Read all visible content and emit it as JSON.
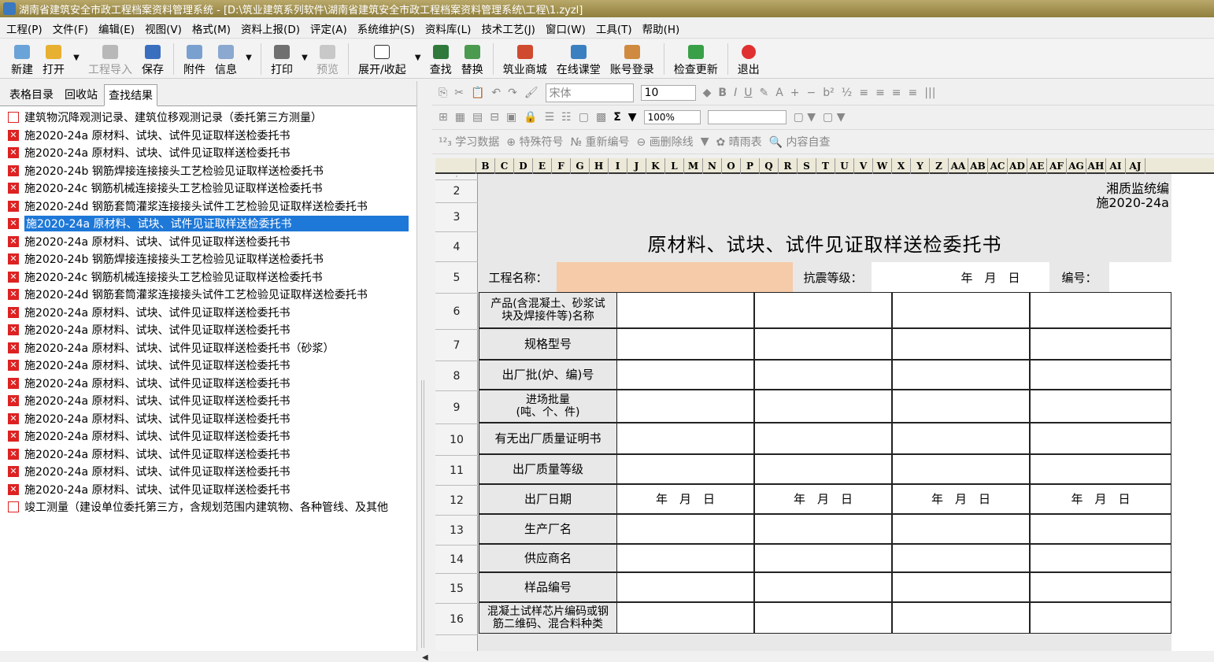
{
  "window": {
    "title": "湖南省建筑安全市政工程档案资料管理系统 - [D:\\筑业建筑系列软件\\湖南省建筑安全市政工程档案资料管理系统\\工程\\1.zyzl]"
  },
  "menu": [
    "工程(P)",
    "文件(F)",
    "编辑(E)",
    "视图(V)",
    "格式(M)",
    "资料上报(D)",
    "评定(A)",
    "系统维护(S)",
    "资料库(L)",
    "技术工艺(J)",
    "窗口(W)",
    "工具(T)",
    "帮助(H)"
  ],
  "toolbar": {
    "new": "新建",
    "open": "打开",
    "import": "工程导入",
    "save": "保存",
    "attach": "附件",
    "info": "信息",
    "print": "打印",
    "preview": "预览",
    "expand": "展开/收起",
    "find": "查找",
    "replace": "替换",
    "mall": "筑业商城",
    "classroom": "在线课堂",
    "login": "账号登录",
    "update": "检查更新",
    "exit": "退出"
  },
  "format": {
    "font": "宋体",
    "size": "10",
    "zoom": "100%",
    "learn": "学习数据",
    "special": "特殊符号",
    "renumber": "重新编号",
    "strike": "画删除线",
    "weather": "晴雨表",
    "check": "内容自查",
    "sigma": "Σ"
  },
  "tabs": [
    "表格目录",
    "回收站",
    "查找结果"
  ],
  "files": [
    {
      "t": "建筑物沉降观测记录、建筑位移观测记录（委托第三方测量）",
      "i": "doc"
    },
    {
      "t": "施2020-24a 原材料、试块、试件见证取样送检委托书",
      "i": "err"
    },
    {
      "t": "施2020-24a 原材料、试块、试件见证取样送检委托书",
      "i": "err"
    },
    {
      "t": "施2020-24b 钢筋焊接连接接头工艺检验见证取样送检委托书",
      "i": "err"
    },
    {
      "t": "施2020-24c 钢筋机械连接接头工艺检验见证取样送检委托书",
      "i": "err"
    },
    {
      "t": "施2020-24d 钢筋套筒灌浆连接接头试件工艺检验见证取样送检委托书",
      "i": "err"
    },
    {
      "t": "施2020-24a 原材料、试块、试件见证取样送检委托书",
      "i": "err",
      "sel": true
    },
    {
      "t": "施2020-24a 原材料、试块、试件见证取样送检委托书",
      "i": "err"
    },
    {
      "t": "施2020-24b 钢筋焊接连接接头工艺检验见证取样送检委托书",
      "i": "err"
    },
    {
      "t": "施2020-24c 钢筋机械连接接头工艺检验见证取样送检委托书",
      "i": "err"
    },
    {
      "t": "施2020-24d 钢筋套筒灌浆连接接头试件工艺检验见证取样送检委托书",
      "i": "err"
    },
    {
      "t": "施2020-24a 原材料、试块、试件见证取样送检委托书",
      "i": "err"
    },
    {
      "t": "施2020-24a 原材料、试块、试件见证取样送检委托书",
      "i": "err"
    },
    {
      "t": "施2020-24a 原材料、试块、试件见证取样送检委托书（砂浆）",
      "i": "err"
    },
    {
      "t": "施2020-24a 原材料、试块、试件见证取样送检委托书",
      "i": "err"
    },
    {
      "t": "施2020-24a 原材料、试块、试件见证取样送检委托书",
      "i": "err"
    },
    {
      "t": "施2020-24a 原材料、试块、试件见证取样送检委托书",
      "i": "err"
    },
    {
      "t": "施2020-24a 原材料、试块、试件见证取样送检委托书",
      "i": "err"
    },
    {
      "t": "施2020-24a 原材料、试块、试件见证取样送检委托书",
      "i": "err"
    },
    {
      "t": "施2020-24a 原材料、试块、试件见证取样送检委托书",
      "i": "err"
    },
    {
      "t": "施2020-24a 原材料、试块、试件见证取样送检委托书",
      "i": "err"
    },
    {
      "t": "施2020-24a 原材料、试块、试件见证取样送检委托书",
      "i": "err"
    },
    {
      "t": "竣工测量（建设单位委托第三方，含规划范围内建筑物、各种管线、及其他",
      "i": "doc"
    }
  ],
  "columns": [
    "B",
    "C",
    "D",
    "E",
    "F",
    "G",
    "H",
    "I",
    "J",
    "K",
    "L",
    "M",
    "N",
    "O",
    "P",
    "Q",
    "R",
    "S",
    "T",
    "U",
    "V",
    "W",
    "X",
    "Y",
    "Z",
    "AA",
    "AB",
    "AC",
    "AD",
    "AE",
    "AF",
    "AG",
    "AH",
    "AI",
    "AJ"
  ],
  "rows": [
    "2",
    "3",
    "4",
    "5",
    "6",
    "7",
    "8",
    "9",
    "10",
    "11",
    "12",
    "13",
    "14",
    "15",
    "16"
  ],
  "sheet": {
    "org": "湘质监统编",
    "code": "施2020-24a",
    "title": "原材料、试块、试件见证取样送检委托书",
    "project_label": "工程名称：",
    "seismic_label": "抗震等级：",
    "date_label": "年　月　日",
    "number_label": "编号：",
    "rows": [
      "产品(含混凝土、砂浆试块及焊接件等)名称",
      "规格型号",
      "出厂批(炉、编)号",
      "进场批量\n(吨、个、件)",
      "有无出厂质量证明书",
      "出厂质量等级",
      "出厂日期",
      "生产厂名",
      "供应商名",
      "样品编号",
      "混凝土试样芯片编码或钢筋二维码、混合料种类"
    ],
    "date_value": "年　月　日"
  },
  "colors": {
    "title_bar": "#8f7f3c",
    "selection": "#1e78d8",
    "project_cell": "#f6cba9"
  }
}
